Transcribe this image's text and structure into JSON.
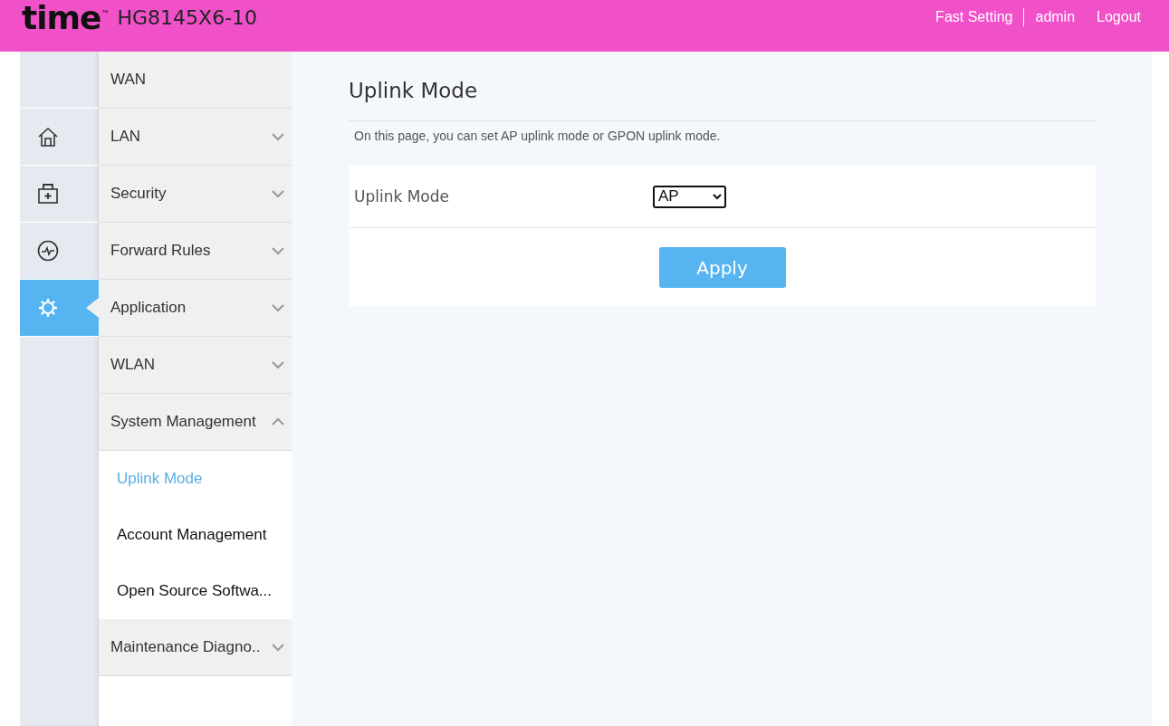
{
  "header": {
    "logo": "time",
    "logo_mark": "™",
    "model": "HG8145X6-10",
    "links": [
      "Fast Setting",
      "admin",
      "Logout"
    ]
  },
  "rail": [
    {
      "kind": "blank"
    },
    {
      "kind": "home",
      "selected": false
    },
    {
      "kind": "security",
      "selected": false
    },
    {
      "kind": "monitor",
      "selected": false
    },
    {
      "kind": "settings",
      "selected": true
    }
  ],
  "menu": [
    {
      "label": "WAN",
      "kind": "link"
    },
    {
      "label": "LAN",
      "kind": "group",
      "expanded": false
    },
    {
      "label": "Security",
      "kind": "group",
      "expanded": false
    },
    {
      "label": "Forward Rules",
      "kind": "group",
      "expanded": false
    },
    {
      "label": "Application",
      "kind": "group",
      "expanded": false
    },
    {
      "label": "WLAN",
      "kind": "group",
      "expanded": false
    },
    {
      "label": "System Management",
      "kind": "group",
      "expanded": true,
      "children": [
        {
          "label": "Uplink Mode",
          "selected": true
        },
        {
          "label": "Account Management",
          "selected": false
        },
        {
          "label": "Open Source Softwa...",
          "selected": false
        }
      ]
    },
    {
      "label": "Maintenance Diagno..",
      "kind": "group",
      "expanded": false
    }
  ],
  "page": {
    "title": "Uplink Mode",
    "description": "On this page, you can set AP uplink mode or GPON uplink mode.",
    "field_label": "Uplink Mode",
    "field_value": "AP",
    "apply_button": "Apply"
  }
}
